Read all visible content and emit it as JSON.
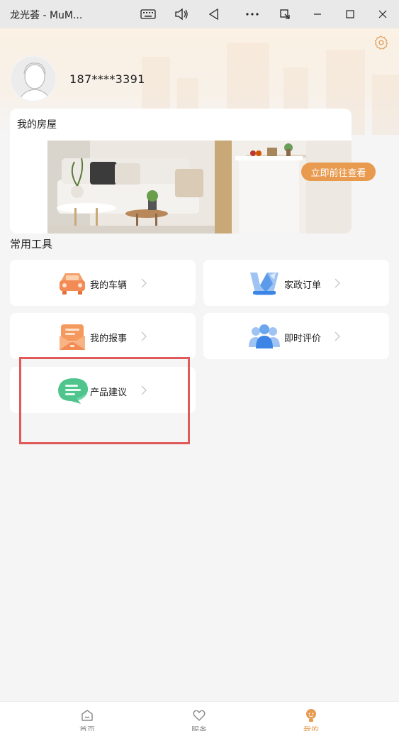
{
  "titlebar": {
    "title": "龙光荟 - MuM...",
    "buttons": [
      "keyboard-icon",
      "volume-icon",
      "back-triangle-icon",
      "more-icon",
      "snap-icon",
      "minimize-icon",
      "maximize-icon",
      "close-icon"
    ]
  },
  "profile": {
    "phone": "187****3391"
  },
  "house": {
    "title": "我的房屋",
    "cta_label": "立即前往查看"
  },
  "tools": {
    "section_title": "常用工具",
    "items": [
      {
        "label": "我的车辆",
        "icon": "car-icon"
      },
      {
        "label": "家政订单",
        "icon": "housekeeping-icon"
      },
      {
        "label": "我的报事",
        "icon": "report-icon"
      },
      {
        "label": "即时评价",
        "icon": "rating-people-icon"
      },
      {
        "label": "产品建议",
        "icon": "suggestion-chat-icon"
      }
    ]
  },
  "nav": {
    "items": [
      {
        "label": "首页",
        "icon": "home-icon",
        "active": false
      },
      {
        "label": "服务",
        "icon": "heart-icon",
        "active": false
      },
      {
        "label": "我的",
        "icon": "profile-icon",
        "active": true
      }
    ]
  },
  "colors": {
    "accent": "#e89a4f",
    "highlight": "#e05a5a",
    "background": "#f5f5f5"
  }
}
